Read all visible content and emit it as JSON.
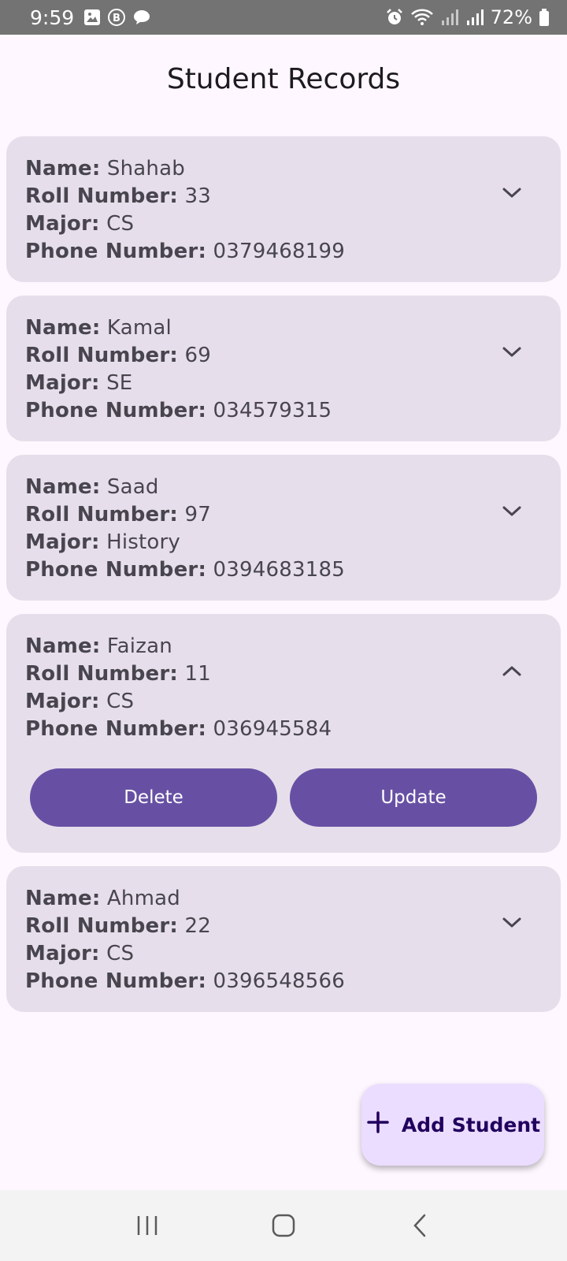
{
  "status_bar": {
    "time": "9:59",
    "battery": "72%",
    "icons": [
      "gallery-icon",
      "b-icon",
      "chat-icon",
      "alarm-icon",
      "wifi-icon",
      "signal-icon",
      "battery-icon"
    ]
  },
  "header": {
    "title": "Student Records"
  },
  "labels": {
    "name": "Name:",
    "roll": "Roll Number:",
    "major": "Major:",
    "phone": "Phone Number:"
  },
  "students": [
    {
      "name": "Shahab",
      "roll": "33",
      "major": "CS",
      "phone": "0379468199",
      "expanded": false
    },
    {
      "name": "Kamal",
      "roll": "69",
      "major": "SE",
      "phone": "034579315",
      "expanded": false
    },
    {
      "name": "Saad",
      "roll": "97",
      "major": "History",
      "phone": "0394683185",
      "expanded": false
    },
    {
      "name": "Faizan",
      "roll": "11",
      "major": "CS",
      "phone": "036945584",
      "expanded": true
    },
    {
      "name": "Ahmad",
      "roll": "22",
      "major": "CS",
      "phone": "0396548566",
      "expanded": false
    }
  ],
  "actions": {
    "delete_label": "Delete",
    "update_label": "Update"
  },
  "fab": {
    "label": "Add Student",
    "icon": "plus-icon"
  },
  "colors": {
    "card_bg": "#e6dfeb",
    "primary": "#6750a4",
    "fab_bg": "#eaddff",
    "page_bg": "#fef7ff"
  },
  "nav": {
    "icons": [
      "recent-apps-icon",
      "home-icon",
      "back-icon"
    ]
  }
}
